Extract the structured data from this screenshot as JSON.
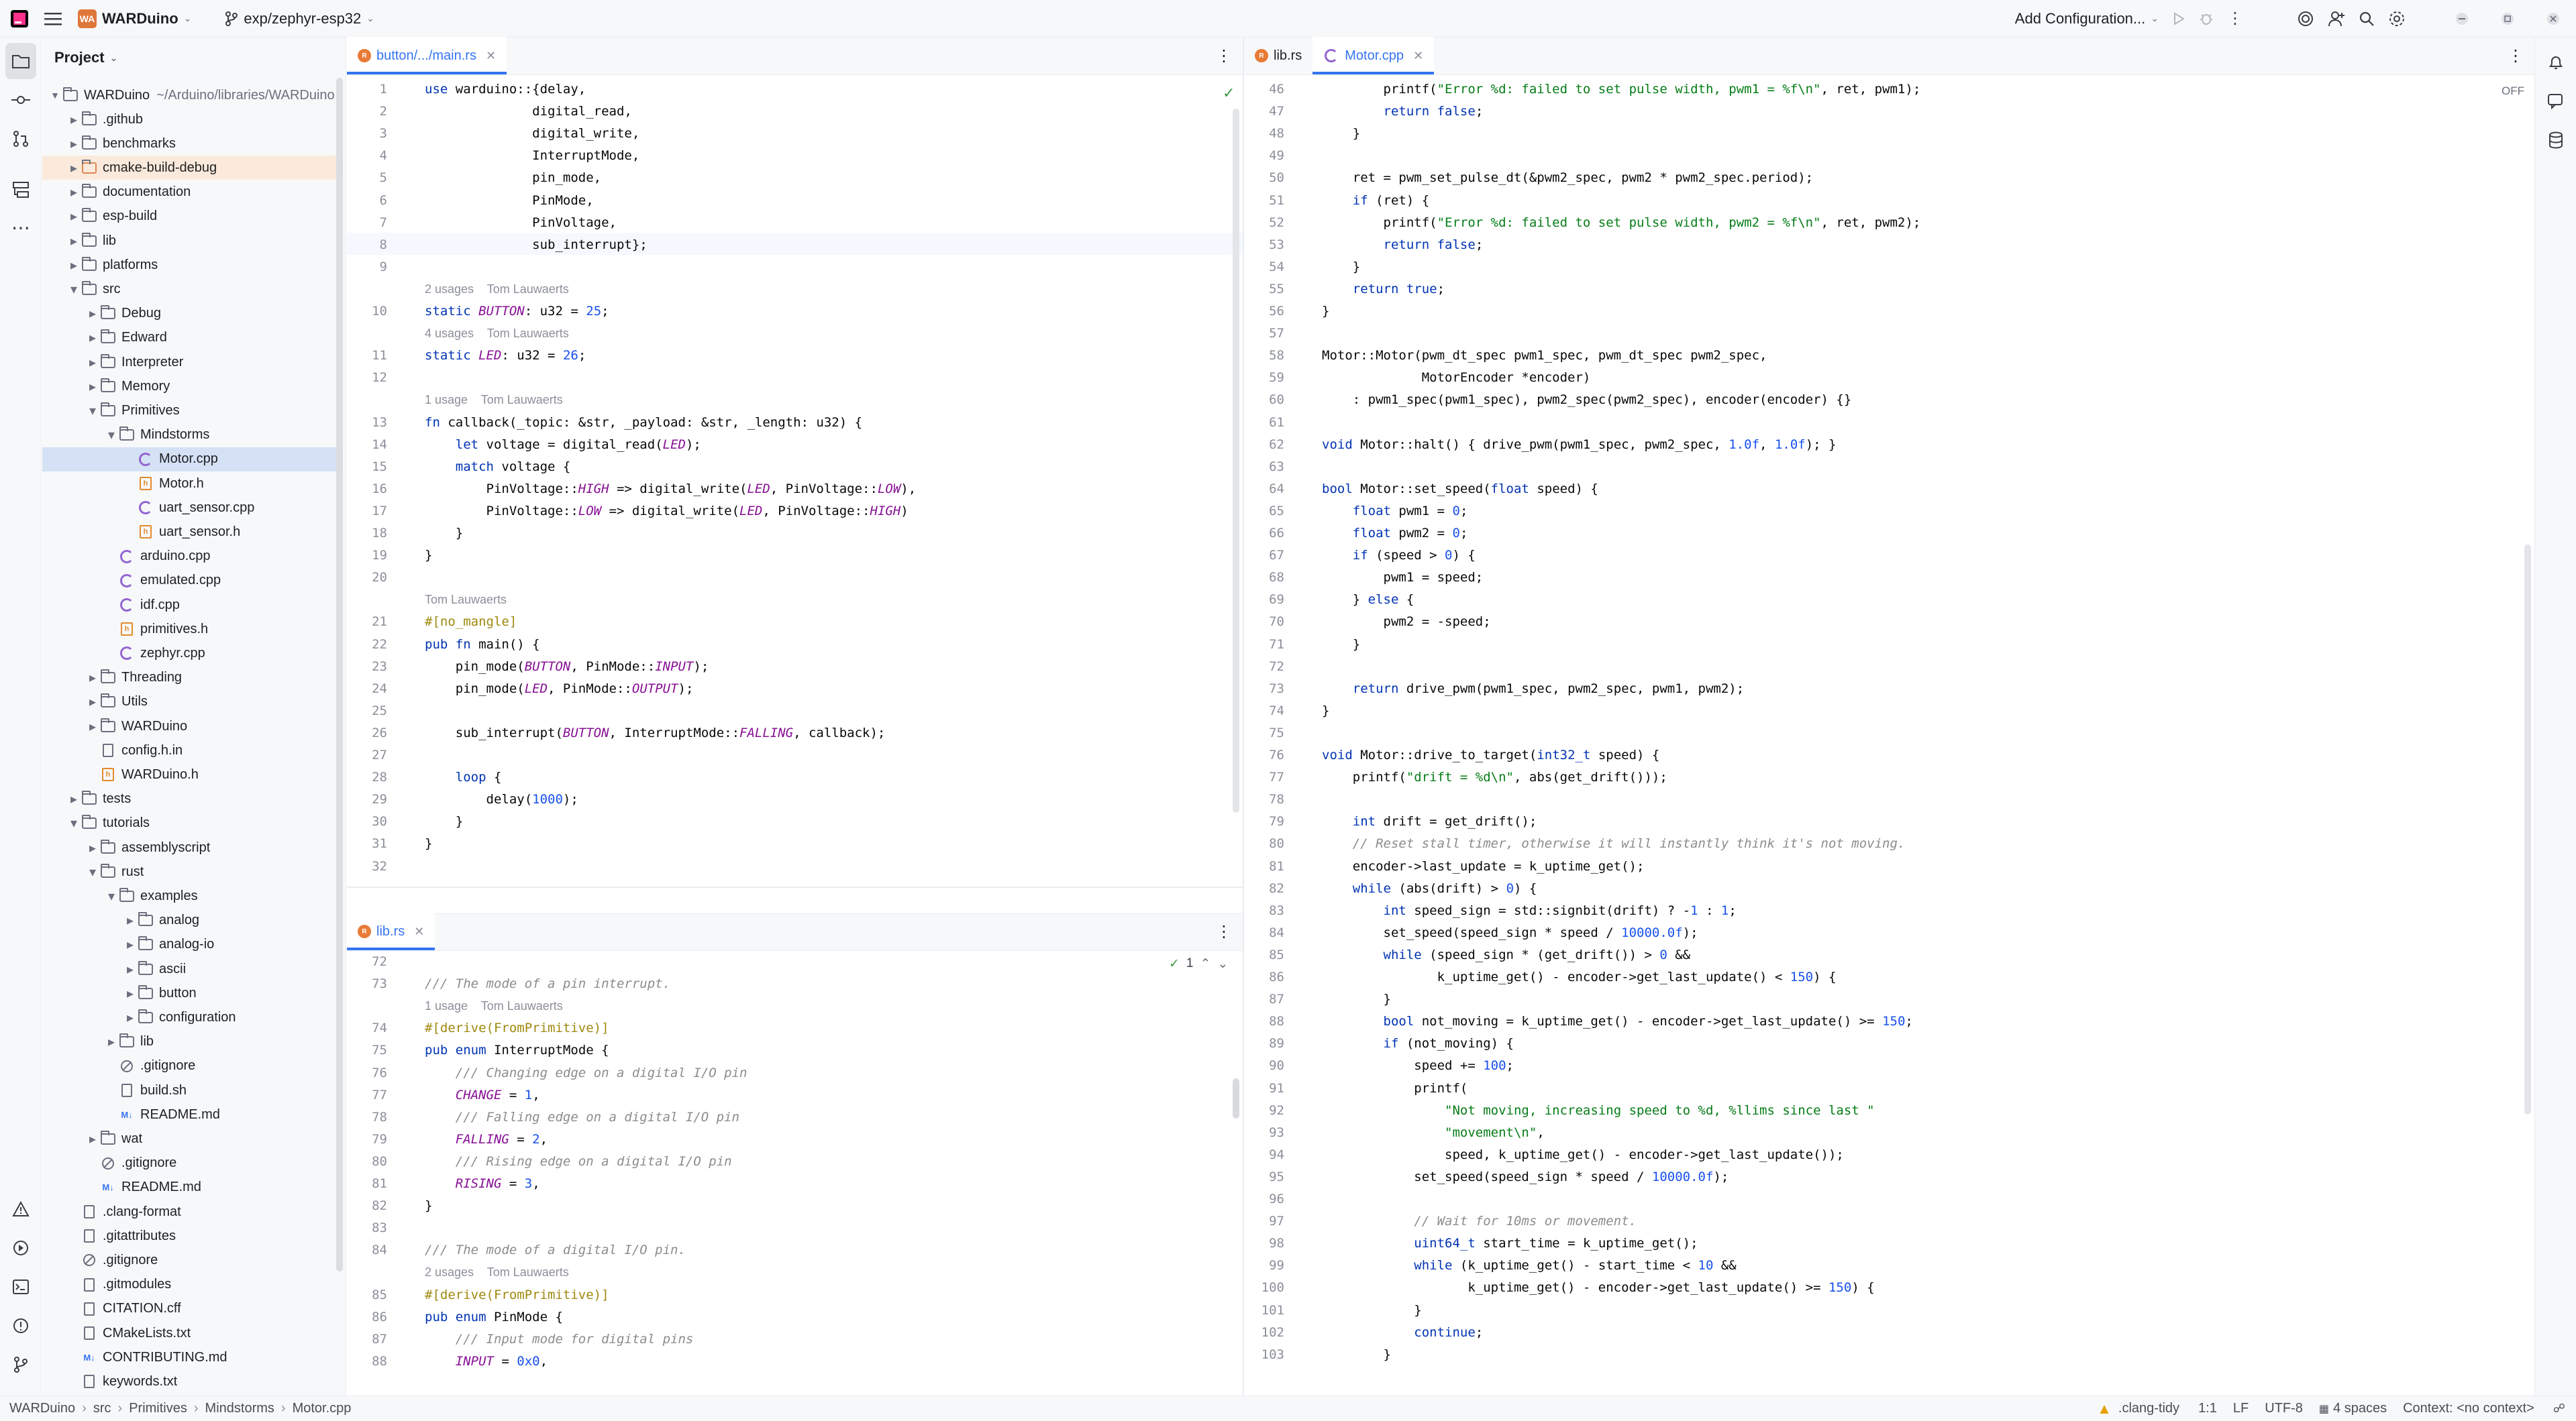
{
  "titlebar": {
    "project_badge": "WA",
    "project_name": "WARDuino",
    "branch": "exp/zephyr-esp32",
    "add_config": "Add Configuration..."
  },
  "project_panel": {
    "title": "Project",
    "root_name": "WARDuino",
    "root_path": "~/Arduino/libraries/WARDuino",
    "tree": [
      {
        "label": ".github",
        "kind": "folder",
        "depth": 1,
        "open": false
      },
      {
        "label": "benchmarks",
        "kind": "folder",
        "depth": 1,
        "open": false
      },
      {
        "label": "cmake-build-debug",
        "kind": "folder-orange",
        "depth": 1,
        "open": false
      },
      {
        "label": "documentation",
        "kind": "folder",
        "depth": 1,
        "open": false
      },
      {
        "label": "esp-build",
        "kind": "folder",
        "depth": 1,
        "open": false
      },
      {
        "label": "lib",
        "kind": "folder",
        "depth": 1,
        "open": false
      },
      {
        "label": "platforms",
        "kind": "folder",
        "depth": 1,
        "open": false
      },
      {
        "label": "src",
        "kind": "folder",
        "depth": 1,
        "open": true
      },
      {
        "label": "Debug",
        "kind": "folder",
        "depth": 2,
        "open": false
      },
      {
        "label": "Edward",
        "kind": "folder",
        "depth": 2,
        "open": false
      },
      {
        "label": "Interpreter",
        "kind": "folder",
        "depth": 2,
        "open": false
      },
      {
        "label": "Memory",
        "kind": "folder",
        "depth": 2,
        "open": false
      },
      {
        "label": "Primitives",
        "kind": "folder",
        "depth": 2,
        "open": true
      },
      {
        "label": "Mindstorms",
        "kind": "folder",
        "depth": 3,
        "open": true
      },
      {
        "label": "Motor.cpp",
        "kind": "cpp",
        "depth": 4
      },
      {
        "label": "Motor.h",
        "kind": "h",
        "depth": 4
      },
      {
        "label": "uart_sensor.cpp",
        "kind": "cpp",
        "depth": 4
      },
      {
        "label": "uart_sensor.h",
        "kind": "h",
        "depth": 4
      },
      {
        "label": "arduino.cpp",
        "kind": "cpp",
        "depth": 3
      },
      {
        "label": "emulated.cpp",
        "kind": "cpp",
        "depth": 3
      },
      {
        "label": "idf.cpp",
        "kind": "cpp",
        "depth": 3
      },
      {
        "label": "primitives.h",
        "kind": "h",
        "depth": 3
      },
      {
        "label": "zephyr.cpp",
        "kind": "cpp",
        "depth": 3
      },
      {
        "label": "Threading",
        "kind": "folder",
        "depth": 2,
        "open": false
      },
      {
        "label": "Utils",
        "kind": "folder",
        "depth": 2,
        "open": false
      },
      {
        "label": "WARDuino",
        "kind": "folder",
        "depth": 2,
        "open": false
      },
      {
        "label": "config.h.in",
        "kind": "gen",
        "depth": 2
      },
      {
        "label": "WARDuino.h",
        "kind": "h",
        "depth": 2
      },
      {
        "label": "tests",
        "kind": "folder",
        "depth": 1,
        "open": false
      },
      {
        "label": "tutorials",
        "kind": "folder",
        "depth": 1,
        "open": true
      },
      {
        "label": "assemblyscript",
        "kind": "folder",
        "depth": 2,
        "open": false
      },
      {
        "label": "rust",
        "kind": "folder",
        "depth": 2,
        "open": true
      },
      {
        "label": "examples",
        "kind": "folder",
        "depth": 3,
        "open": true
      },
      {
        "label": "analog",
        "kind": "folder",
        "depth": 4,
        "open": false
      },
      {
        "label": "analog-io",
        "kind": "folder",
        "depth": 4,
        "open": false
      },
      {
        "label": "ascii",
        "kind": "folder",
        "depth": 4,
        "open": false
      },
      {
        "label": "button",
        "kind": "folder",
        "depth": 4,
        "open": false
      },
      {
        "label": "configuration",
        "kind": "folder",
        "depth": 4,
        "open": false
      },
      {
        "label": "lib",
        "kind": "folder",
        "depth": 3,
        "open": false
      },
      {
        "label": ".gitignore",
        "kind": "ignore",
        "depth": 3
      },
      {
        "label": "build.sh",
        "kind": "gen",
        "depth": 3
      },
      {
        "label": "README.md",
        "kind": "md",
        "depth": 3
      },
      {
        "label": "wat",
        "kind": "folder",
        "depth": 2,
        "open": false
      },
      {
        "label": ".gitignore",
        "kind": "ignore",
        "depth": 2
      },
      {
        "label": "README.md",
        "kind": "md",
        "depth": 2
      },
      {
        "label": ".clang-format",
        "kind": "gen",
        "depth": 1
      },
      {
        "label": ".gitattributes",
        "kind": "gen",
        "depth": 1
      },
      {
        "label": ".gitignore",
        "kind": "ignore",
        "depth": 1
      },
      {
        "label": ".gitmodules",
        "kind": "gen",
        "depth": 1
      },
      {
        "label": "CITATION.cff",
        "kind": "gen",
        "depth": 1
      },
      {
        "label": "CMakeLists.txt",
        "kind": "gen",
        "depth": 1
      },
      {
        "label": "CONTRIBUTING.md",
        "kind": "md",
        "depth": 1
      },
      {
        "label": "keywords.txt",
        "kind": "gen",
        "depth": 1
      }
    ]
  },
  "editor_main": {
    "tab": "button/.../main.rs",
    "lines": [
      {
        "n": "1",
        "t": "use warduino::{delay,"
      },
      {
        "n": "2",
        "t": "              digital_read,"
      },
      {
        "n": "3",
        "t": "              digital_write,"
      },
      {
        "n": "4",
        "t": "              InterruptMode,"
      },
      {
        "n": "5",
        "t": "              pin_mode,"
      },
      {
        "n": "6",
        "t": "              PinMode,"
      },
      {
        "n": "7",
        "t": "              PinVoltage,"
      },
      {
        "n": "8",
        "t": "              sub_interrupt};"
      },
      {
        "n": "9",
        "t": ""
      },
      {
        "hint": "2 usages    Tom Lauwaerts"
      },
      {
        "n": "10",
        "t": "static BUTTON: u32 = 25;"
      },
      {
        "hint": "4 usages    Tom Lauwaerts"
      },
      {
        "n": "11",
        "t": "static LED: u32 = 26;"
      },
      {
        "n": "12",
        "t": ""
      },
      {
        "hint": "1 usage    Tom Lauwaerts"
      },
      {
        "n": "13",
        "t": "fn callback(_topic: &str, _payload: &str, _length: u32) {"
      },
      {
        "n": "14",
        "t": "    let voltage = digital_read(LED);"
      },
      {
        "n": "15",
        "t": "    match voltage {"
      },
      {
        "n": "16",
        "t": "        PinVoltage::HIGH => digital_write(LED, PinVoltage::LOW),"
      },
      {
        "n": "17",
        "t": "        PinVoltage::LOW => digital_write(LED, PinVoltage::HIGH)"
      },
      {
        "n": "18",
        "t": "    }"
      },
      {
        "n": "19",
        "t": "}"
      },
      {
        "n": "20",
        "t": ""
      },
      {
        "hint": "Tom Lauwaerts"
      },
      {
        "n": "21",
        "t": "#[no_mangle]"
      },
      {
        "n": "22",
        "t": "pub fn main() {"
      },
      {
        "n": "23",
        "t": "    pin_mode(BUTTON, PinMode::INPUT);"
      },
      {
        "n": "24",
        "t": "    pin_mode(LED, PinMode::OUTPUT);"
      },
      {
        "n": "25",
        "t": ""
      },
      {
        "n": "26",
        "t": "    sub_interrupt(BUTTON, InterruptMode::FALLING, callback);"
      },
      {
        "n": "27",
        "t": ""
      },
      {
        "n": "28",
        "t": "    loop {"
      },
      {
        "n": "29",
        "t": "        delay(1000);"
      },
      {
        "n": "30",
        "t": "    }"
      },
      {
        "n": "31",
        "t": "}"
      },
      {
        "n": "32",
        "t": ""
      }
    ]
  },
  "editor_lib": {
    "tab": "lib.rs",
    "inspection_count": "1",
    "lines": [
      {
        "n": "72",
        "t": ""
      },
      {
        "n": "73",
        "t": "/// The mode of a pin interrupt."
      },
      {
        "hint": "1 usage    Tom Lauwaerts"
      },
      {
        "n": "74",
        "t": "#[derive(FromPrimitive)]"
      },
      {
        "n": "75",
        "t": "pub enum InterruptMode {"
      },
      {
        "n": "76",
        "t": "    /// Changing edge on a digital I/O pin"
      },
      {
        "n": "77",
        "t": "    CHANGE = 1,"
      },
      {
        "n": "78",
        "t": "    /// Falling edge on a digital I/O pin"
      },
      {
        "n": "79",
        "t": "    FALLING = 2,"
      },
      {
        "n": "80",
        "t": "    /// Rising edge on a digital I/O pin"
      },
      {
        "n": "81",
        "t": "    RISING = 3,"
      },
      {
        "n": "82",
        "t": "}"
      },
      {
        "n": "83",
        "t": ""
      },
      {
        "n": "84",
        "t": "/// The mode of a digital I/O pin."
      },
      {
        "hint": "2 usages    Tom Lauwaerts"
      },
      {
        "n": "85",
        "t": "#[derive(FromPrimitive)]"
      },
      {
        "n": "86",
        "t": "pub enum PinMode {"
      },
      {
        "n": "87",
        "t": "    /// Input mode for digital pins"
      },
      {
        "n": "88",
        "t": "    INPUT = 0x0,"
      }
    ]
  },
  "editor_right": {
    "tabs": [
      "lib.rs",
      "Motor.cpp"
    ],
    "active_tab": "Motor.cpp",
    "off_label": "OFF",
    "lines": [
      {
        "n": "46",
        "t": "        printf(\"Error %d: failed to set pulse width, pwm1 = %f\\n\", ret, pwm1);"
      },
      {
        "n": "47",
        "t": "        return false;"
      },
      {
        "n": "48",
        "t": "    }"
      },
      {
        "n": "49",
        "t": ""
      },
      {
        "n": "50",
        "t": "    ret = pwm_set_pulse_dt(&pwm2_spec, pwm2 * pwm2_spec.period);"
      },
      {
        "n": "51",
        "t": "    if (ret) {"
      },
      {
        "n": "52",
        "t": "        printf(\"Error %d: failed to set pulse width, pwm2 = %f\\n\", ret, pwm2);"
      },
      {
        "n": "53",
        "t": "        return false;"
      },
      {
        "n": "54",
        "t": "    }"
      },
      {
        "n": "55",
        "t": "    return true;"
      },
      {
        "n": "56",
        "t": "}"
      },
      {
        "n": "57",
        "t": ""
      },
      {
        "n": "58",
        "t": "Motor::Motor(pwm_dt_spec pwm1_spec, pwm_dt_spec pwm2_spec,"
      },
      {
        "n": "59",
        "t": "             MotorEncoder *encoder)"
      },
      {
        "n": "60",
        "t": "    : pwm1_spec(pwm1_spec), pwm2_spec(pwm2_spec), encoder(encoder) {}"
      },
      {
        "n": "61",
        "t": ""
      },
      {
        "n": "62",
        "t": "void Motor::halt() { drive_pwm(pwm1_spec, pwm2_spec, 1.0f, 1.0f); }"
      },
      {
        "n": "63",
        "t": ""
      },
      {
        "n": "64",
        "t": "bool Motor::set_speed(float speed) {"
      },
      {
        "n": "65",
        "t": "    float pwm1 = 0;"
      },
      {
        "n": "66",
        "t": "    float pwm2 = 0;"
      },
      {
        "n": "67",
        "t": "    if (speed > 0) {"
      },
      {
        "n": "68",
        "t": "        pwm1 = speed;"
      },
      {
        "n": "69",
        "t": "    } else {"
      },
      {
        "n": "70",
        "t": "        pwm2 = -speed;"
      },
      {
        "n": "71",
        "t": "    }"
      },
      {
        "n": "72",
        "t": ""
      },
      {
        "n": "73",
        "t": "    return drive_pwm(pwm1_spec, pwm2_spec, pwm1, pwm2);"
      },
      {
        "n": "74",
        "t": "}"
      },
      {
        "n": "75",
        "t": ""
      },
      {
        "n": "76",
        "t": "void Motor::drive_to_target(int32_t speed) {"
      },
      {
        "n": "77",
        "t": "    printf(\"drift = %d\\n\", abs(get_drift()));"
      },
      {
        "n": "78",
        "t": ""
      },
      {
        "n": "79",
        "t": "    int drift = get_drift();"
      },
      {
        "n": "80",
        "t": "    // Reset stall timer, otherwise it will instantly think it's not moving."
      },
      {
        "n": "81",
        "t": "    encoder->last_update = k_uptime_get();"
      },
      {
        "n": "82",
        "t": "    while (abs(drift) > 0) {"
      },
      {
        "n": "83",
        "t": "        int speed_sign = std::signbit(drift) ? -1 : 1;"
      },
      {
        "n": "84",
        "t": "        set_speed(speed_sign * speed / 10000.0f);"
      },
      {
        "n": "85",
        "t": "        while (speed_sign * (get_drift()) > 0 &&"
      },
      {
        "n": "86",
        "t": "               k_uptime_get() - encoder->get_last_update() < 150) {"
      },
      {
        "n": "87",
        "t": "        }"
      },
      {
        "n": "88",
        "t": "        bool not_moving = k_uptime_get() - encoder->get_last_update() >= 150;"
      },
      {
        "n": "89",
        "t": "        if (not_moving) {"
      },
      {
        "n": "90",
        "t": "            speed += 100;"
      },
      {
        "n": "91",
        "t": "            printf("
      },
      {
        "n": "92",
        "t": "                \"Not moving, increasing speed to %d, %llims since last \""
      },
      {
        "n": "93",
        "t": "                \"movement\\n\","
      },
      {
        "n": "94",
        "t": "                speed, k_uptime_get() - encoder->get_last_update());"
      },
      {
        "n": "95",
        "t": "            set_speed(speed_sign * speed / 10000.0f);"
      },
      {
        "n": "96",
        "t": ""
      },
      {
        "n": "97",
        "t": "            // Wait for 10ms or movement."
      },
      {
        "n": "98",
        "t": "            uint64_t start_time = k_uptime_get();"
      },
      {
        "n": "99",
        "t": "            while (k_uptime_get() - start_time < 10 &&"
      },
      {
        "n": "100",
        "t": "                   k_uptime_get() - encoder->get_last_update() >= 150) {"
      },
      {
        "n": "101",
        "t": "            }"
      },
      {
        "n": "102",
        "t": "            continue;"
      },
      {
        "n": "103",
        "t": "        }"
      }
    ]
  },
  "statusbar": {
    "breadcrumbs": [
      "WARDuino",
      "src",
      "Primitives",
      "Mindstorms",
      "Motor.cpp"
    ],
    "clang_tidy": ".clang-tidy",
    "position": "1:1",
    "line_sep": "LF",
    "encoding": "UTF-8",
    "indent": "4 spaces",
    "context": "Context: <no context>"
  },
  "colors": {
    "accent": "#3574f0",
    "selection": "#d5e1f4",
    "warning": "#e5a000"
  }
}
